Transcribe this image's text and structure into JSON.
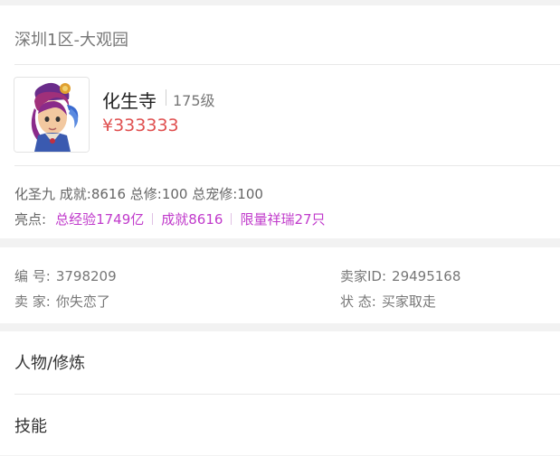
{
  "listing": {
    "server": "深圳1区-大观园",
    "character": {
      "name": "化生寺",
      "level": "175级"
    },
    "price": "¥333333",
    "stats": "化圣九 成就:8616 总修:100 总宠修:100",
    "highlights": {
      "label": "亮点:",
      "tags": [
        "总经验1749亿",
        "成就8616",
        "限量祥瑞27只"
      ]
    }
  },
  "details": {
    "number": {
      "label": "编 号:",
      "value": "3798209"
    },
    "seller_id": {
      "label": "卖家ID:",
      "value": "29495168"
    },
    "seller": {
      "label": "卖 家:",
      "value": "你失恋了"
    },
    "status": {
      "label": "状 态:",
      "value": "买家取走"
    }
  },
  "sections": [
    {
      "label": "人物/修炼"
    },
    {
      "label": "技能"
    }
  ],
  "colors": {
    "price": "#e05050",
    "highlight": "#c03acb",
    "page_bg": "#f2f2f2"
  }
}
